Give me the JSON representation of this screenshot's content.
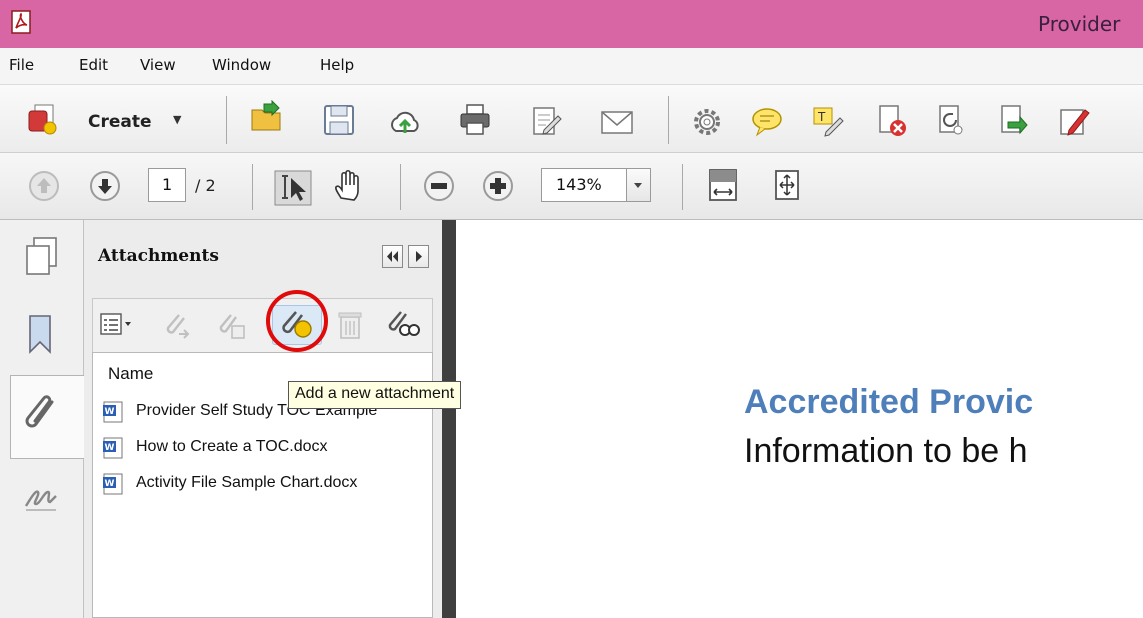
{
  "window": {
    "title": "Provider"
  },
  "menu": [
    "File",
    "Edit",
    "View",
    "Window",
    "Help"
  ],
  "toolbar": {
    "create_label": "Create",
    "icons": [
      "create-icon",
      "open-icon",
      "save-icon",
      "cloud-upload-icon",
      "print-icon",
      "edit-icon",
      "email-icon",
      "settings-icon",
      "comment-icon",
      "highlight-icon",
      "delete-pdf-icon",
      "rotate-pdf-icon",
      "export-pdf-icon",
      "sign-icon"
    ]
  },
  "navigation": {
    "page_current": "1",
    "page_total": "/ 2",
    "zoom": "143%"
  },
  "attachments_panel": {
    "title": "Attachments",
    "column_header": "Name",
    "files": [
      {
        "name": "Provider Self Study TOC Example"
      },
      {
        "name": "How to Create a TOC.docx"
      },
      {
        "name": "Activity File Sample Chart.docx"
      }
    ],
    "tooltip": "Add a new attachment"
  },
  "document": {
    "heading": "Accredited Provic",
    "subheading": "Information to be h"
  },
  "colors": {
    "titlebar": "#d865a4",
    "heading": "#4f7fba",
    "highlight": "#e00a0a",
    "tooltip_bg": "#ffffe1"
  }
}
